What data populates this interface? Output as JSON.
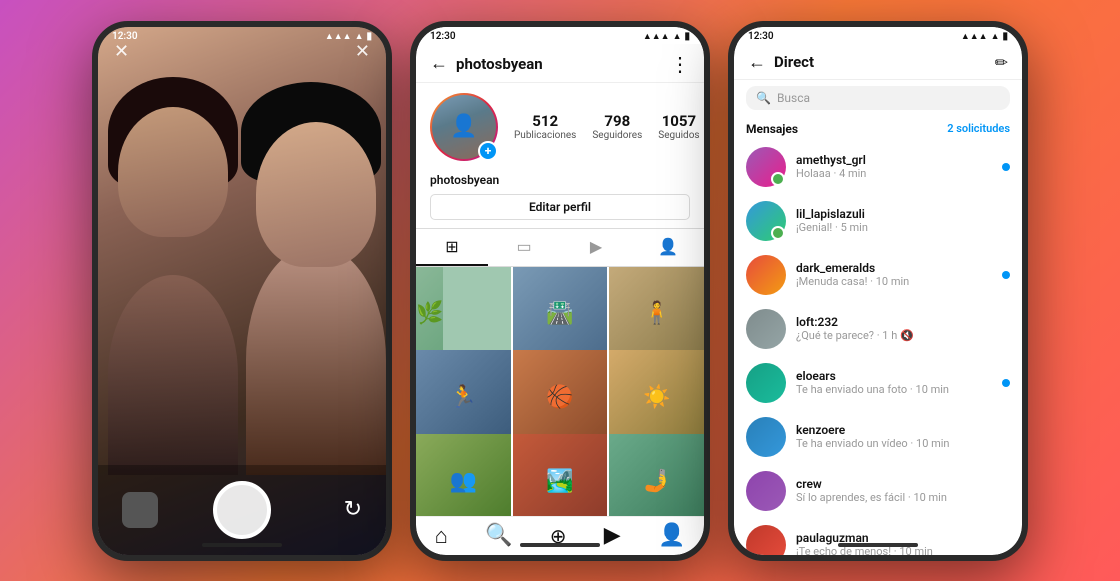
{
  "background": {
    "gradient": "linear-gradient(135deg, #c850c0 0%, #f77737 50%, #ff5a5a 100%)"
  },
  "phone1": {
    "statusBar": {
      "time": "12:30",
      "signal": "▲▲▲",
      "wifi": "wifi",
      "battery": "▮"
    },
    "camera": {
      "flashIcon": "✕",
      "closeIcon": "✕",
      "shutterLabel": "shutter",
      "flipLabel": "flip"
    }
  },
  "phone2": {
    "statusBar": {
      "time": "12:30"
    },
    "profile": {
      "username": "photosbyean",
      "stats": {
        "posts": "512",
        "postsLabel": "Publicaciones",
        "followers": "798",
        "followersLabel": "Seguidores",
        "following": "1057",
        "followingLabel": "Seguidos"
      },
      "editButton": "Editar perfil",
      "tabs": [
        "grid",
        "reels",
        "igtv",
        "tag"
      ]
    },
    "nav": {
      "home": "⌂",
      "search": "🔍",
      "add": "＋",
      "reels": "▶",
      "profile": "👤"
    }
  },
  "phone3": {
    "statusBar": {
      "time": "12:30"
    },
    "direct": {
      "backIcon": "←",
      "title": "Direct",
      "editIcon": "✏",
      "searchPlaceholder": "Busca",
      "messagesLabel": "Mensajes",
      "solicitudesLabel": "2 solicitudes",
      "conversations": [
        {
          "user": "amethyst_grl",
          "preview": "Holaaa · 4 min",
          "unread": true,
          "online": true
        },
        {
          "user": "lil_lapislazuli",
          "preview": "¡Genial! · 5 min",
          "unread": false,
          "online": true
        },
        {
          "user": "dark_emeralds",
          "preview": "¡Menuda casa! · 10 min",
          "unread": true,
          "online": false
        },
        {
          "user": "loft:232",
          "preview": "¿Qué te parece? · 1 h",
          "unread": false,
          "online": false
        },
        {
          "user": "eloears",
          "preview": "Te ha enviado una foto · 10 min",
          "unread": true,
          "online": false
        },
        {
          "user": "kenzoere",
          "preview": "Te ha enviado un vídeo · 10 min",
          "unread": false,
          "online": false
        },
        {
          "user": "crew",
          "preview": "Sí lo aprendes, es fácil · 10 min",
          "unread": false,
          "online": false
        },
        {
          "user": "paulaguzman",
          "preview": "¡Te echo de menos! · 10 min",
          "unread": false,
          "online": false
        }
      ]
    }
  }
}
